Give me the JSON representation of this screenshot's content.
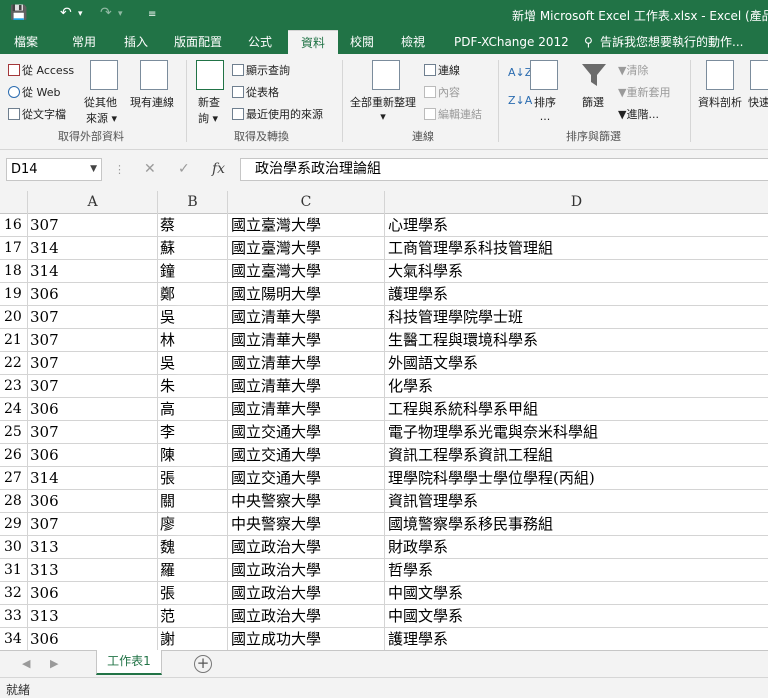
{
  "title_bar": {
    "title": "新增 Microsoft Excel 工作表.xlsx - Excel (產品啟動",
    "save_icon": "save-icon",
    "undo_icon": "undo-icon",
    "redo_icon": "redo-icon",
    "customize_icon": "customize-qat-icon"
  },
  "tabs": [
    {
      "label": "檔案"
    },
    {
      "label": "常用"
    },
    {
      "label": "插入"
    },
    {
      "label": "版面配置"
    },
    {
      "label": "公式"
    },
    {
      "label": "資料",
      "active": true
    },
    {
      "label": "校閱"
    },
    {
      "label": "檢視"
    },
    {
      "label": "PDF-XChange 2012"
    },
    {
      "label": "告訴我您想要執行的動作..."
    }
  ],
  "ribbon": {
    "external_data": {
      "from_access": "從 Access",
      "from_web": "從 Web",
      "from_text": "從文字檔",
      "from_other_line1": "從其他",
      "from_other_line2": "來源",
      "existing_conn": "現有連線",
      "label": "取得外部資料"
    },
    "get_transform": {
      "new_query_line1": "新查",
      "new_query_line2": "詢",
      "show_queries": "顯示查詢",
      "from_table": "從表格",
      "recent_sources": "最近使用的來源",
      "label": "取得及轉換"
    },
    "connections": {
      "refresh_all": "全部重新整理",
      "connections": "連線",
      "properties": "內容",
      "edit_links": "編輯連結",
      "label": "連線"
    },
    "sort_filter": {
      "sort": "排序",
      "filter": "篩選",
      "clear": "清除",
      "reapply": "重新套用",
      "advanced": "進階...",
      "label": "排序與篩選"
    },
    "data_tools": {
      "text_to_columns": "資料剖析",
      "flash_fill": "快速"
    }
  },
  "formula_bar": {
    "name_box": "D14",
    "formula": "政治學系政治理論組"
  },
  "columns": [
    "A",
    "B",
    "C",
    "D"
  ],
  "rows": [
    {
      "num": "16",
      "a": "307",
      "b": "蔡",
      "c": "國立臺灣大學",
      "d": "心理學系"
    },
    {
      "num": "17",
      "a": "314",
      "b": "蘇",
      "c": "國立臺灣大學",
      "d": "工商管理學系科技管理組"
    },
    {
      "num": "18",
      "a": "314",
      "b": "鐘",
      "c": "國立臺灣大學",
      "d": "大氣科學系"
    },
    {
      "num": "19",
      "a": "306",
      "b": "鄭",
      "c": "國立陽明大學",
      "d": "護理學系"
    },
    {
      "num": "20",
      "a": "307",
      "b": "吳",
      "c": "國立清華大學",
      "d": "科技管理學院學士班"
    },
    {
      "num": "21",
      "a": "307",
      "b": "林",
      "c": "國立清華大學",
      "d": "生醫工程與環境科學系"
    },
    {
      "num": "22",
      "a": "307",
      "b": "吳",
      "c": "國立清華大學",
      "d": "外國語文學系"
    },
    {
      "num": "23",
      "a": "307",
      "b": "朱",
      "c": "國立清華大學",
      "d": "化學系"
    },
    {
      "num": "24",
      "a": "306",
      "b": "高",
      "c": "國立清華大學",
      "d": "工程與系統科學系甲組"
    },
    {
      "num": "25",
      "a": "307",
      "b": "李",
      "c": "國立交通大學",
      "d": "電子物理學系光電與奈米科學組"
    },
    {
      "num": "26",
      "a": "306",
      "b": "陳",
      "c": "國立交通大學",
      "d": "資訊工程學系資訊工程組"
    },
    {
      "num": "27",
      "a": "314",
      "b": "張",
      "c": "國立交通大學",
      "d": "理學院科學學士學位學程(丙組)"
    },
    {
      "num": "28",
      "a": "306",
      "b": "關",
      "c": "中央警察大學",
      "d": "資訊管理學系"
    },
    {
      "num": "29",
      "a": "307",
      "b": "廖",
      "c": "中央警察大學",
      "d": "國境警察學系移民事務組"
    },
    {
      "num": "30",
      "a": "313",
      "b": "魏",
      "c": "國立政治大學",
      "d": "財政學系"
    },
    {
      "num": "31",
      "a": "313",
      "b": "羅",
      "c": "國立政治大學",
      "d": "哲學系"
    },
    {
      "num": "32",
      "a": "306",
      "b": "張",
      "c": "國立政治大學",
      "d": "中國文學系"
    },
    {
      "num": "33",
      "a": "313",
      "b": "范",
      "c": "國立政治大學",
      "d": "中國文學系"
    },
    {
      "num": "34",
      "a": "306",
      "b": "謝",
      "c": "國立成功大學",
      "d": "護理學系"
    }
  ],
  "sheet_tabs": [
    {
      "label": "工作表1"
    }
  ],
  "status": {
    "text": "就緒"
  }
}
